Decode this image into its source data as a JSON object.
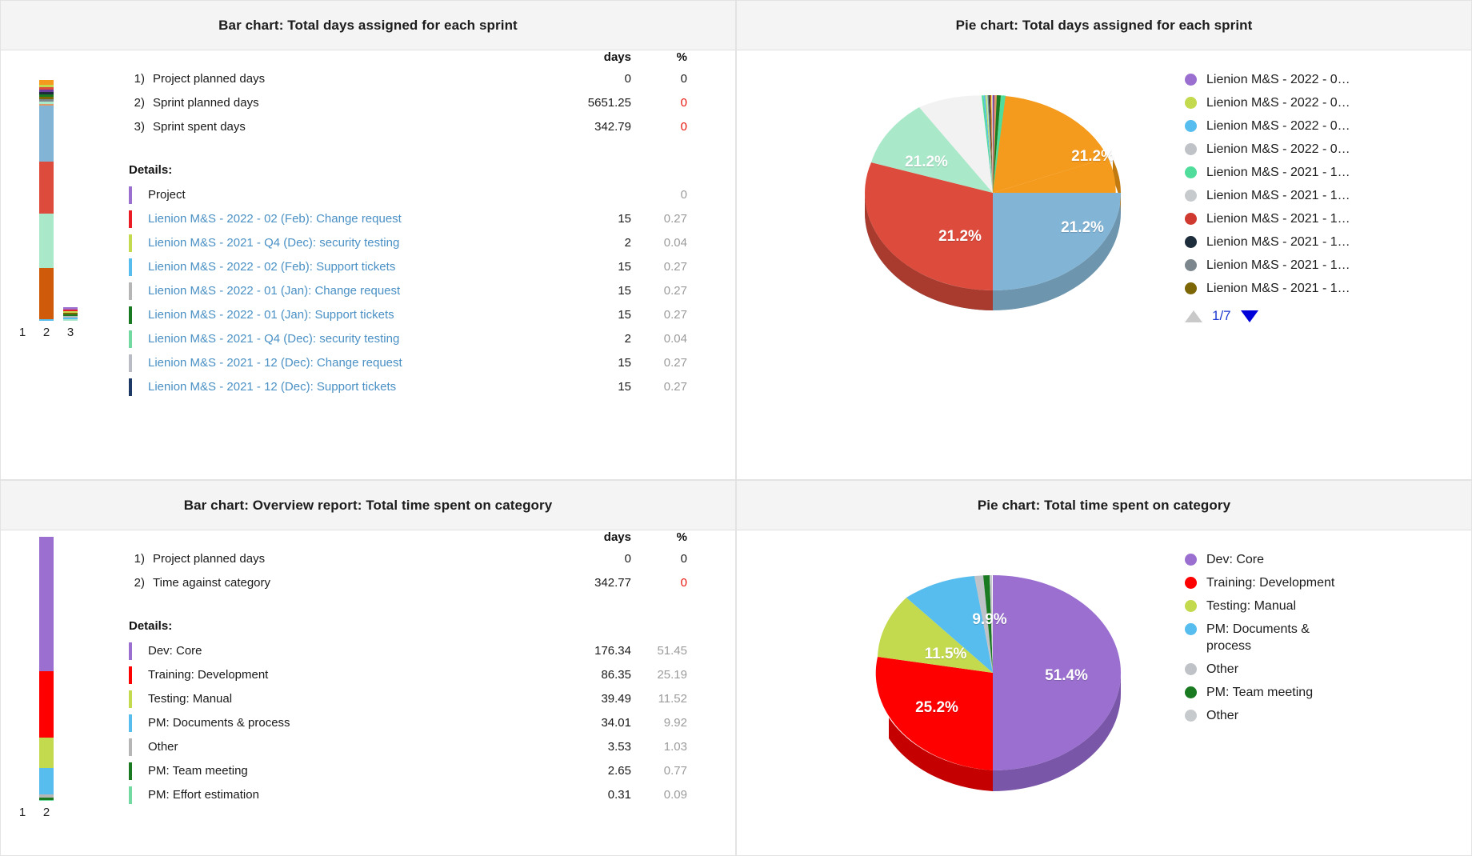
{
  "panels": {
    "bar_sprint": {
      "title": "Bar chart: Total days assigned for each sprint",
      "columns": {
        "days": "days",
        "pct": "%"
      },
      "summary": [
        {
          "idx": "1)",
          "label": "Project planned days",
          "days": "0",
          "pct": "0",
          "pct_red": false
        },
        {
          "idx": "2)",
          "label": "Sprint planned days",
          "days": "5651.25",
          "pct": "0",
          "pct_red": true
        },
        {
          "idx": "3)",
          "label": "Sprint spent days",
          "days": "342.79",
          "pct": "0",
          "pct_red": true
        }
      ],
      "details_label": "Details:",
      "details": [
        {
          "color": "#9a6fd0",
          "label": "Project",
          "days": "",
          "pct": "0",
          "link": false
        },
        {
          "color": "#ec1c24",
          "label": "Lienion M&S - 2022 - 02 (Feb): Change request",
          "days": "15",
          "pct": "0.27",
          "link": true
        },
        {
          "color": "#c3d94e",
          "label": "Lienion M&S - 2021 - Q4 (Dec): security testing",
          "days": "2",
          "pct": "0.04",
          "link": true
        },
        {
          "color": "#56bdee",
          "label": "Lienion M&S - 2022 - 02 (Feb): Support tickets",
          "days": "15",
          "pct": "0.27",
          "link": true
        },
        {
          "color": "#b6b6b6",
          "label": "Lienion M&S - 2022 - 01 (Jan): Change request",
          "days": "15",
          "pct": "0.27",
          "link": true
        },
        {
          "color": "#1a7a22",
          "label": "Lienion M&S - 2022 - 01 (Jan): Support tickets",
          "days": "15",
          "pct": "0.27",
          "link": true
        },
        {
          "color": "#72d9a0",
          "label": "Lienion M&S - 2021 - Q4 (Dec): security testing",
          "days": "2",
          "pct": "0.04",
          "link": true
        },
        {
          "color": "#b9bcc4",
          "label": "Lienion M&S - 2021 - 12 (Dec): Change request",
          "days": "15",
          "pct": "0.27",
          "link": true
        },
        {
          "color": "#1d3a66",
          "label": "Lienion M&S - 2021 - 12 (Dec): Support tickets",
          "days": "15",
          "pct": "0.27",
          "link": true
        }
      ],
      "axis_ticks": [
        "1",
        "2",
        "3"
      ]
    },
    "pie_sprint": {
      "title": "Pie chart: Total days assigned for each sprint",
      "legend": [
        {
          "color": "#9a6fd0",
          "label": "Lienion M&S - 2022 - 0…"
        },
        {
          "color": "#c3d94e",
          "label": "Lienion M&S - 2022 - 0…"
        },
        {
          "color": "#56bdee",
          "label": "Lienion M&S - 2022 - 0…"
        },
        {
          "color": "#bfc2c6",
          "label": "Lienion M&S - 2022 - 0…"
        },
        {
          "color": "#50dd9b",
          "label": "Lienion M&S - 2021 - 1…"
        },
        {
          "color": "#c7cacd",
          "label": "Lienion M&S - 2021 - 1…"
        },
        {
          "color": "#d0392f",
          "label": "Lienion M&S - 2021 - 1…"
        },
        {
          "color": "#1e2d3c",
          "label": "Lienion M&S - 2021 - 1…"
        },
        {
          "color": "#7b878c",
          "label": "Lienion M&S - 2021 - 1…"
        },
        {
          "color": "#7c6606",
          "label": "Lienion M&S - 2021 - 1…"
        }
      ],
      "pager": {
        "prev": "▲",
        "count": "1/7",
        "next": "▼"
      }
    },
    "bar_category": {
      "title": "Bar chart: Overview report: Total time spent on category",
      "columns": {
        "days": "days",
        "pct": "%"
      },
      "summary": [
        {
          "idx": "1)",
          "label": "Project planned days",
          "days": "0",
          "pct": "0",
          "pct_red": false
        },
        {
          "idx": "2)",
          "label": "Time against category",
          "days": "342.77",
          "pct": "0",
          "pct_red": true
        }
      ],
      "details_label": "Details:",
      "details": [
        {
          "color": "#9a6fd0",
          "label": "Dev: Core",
          "days": "176.34",
          "pct": "51.45"
        },
        {
          "color": "#fe0000",
          "label": "Training: Development",
          "days": "86.35",
          "pct": "25.19"
        },
        {
          "color": "#c3d94e",
          "label": "Testing: Manual",
          "days": "39.49",
          "pct": "11.52"
        },
        {
          "color": "#56bdee",
          "label": "PM: Documents & process",
          "days": "34.01",
          "pct": "9.92"
        },
        {
          "color": "#b6b6b6",
          "label": "Other",
          "days": "3.53",
          "pct": "1.03"
        },
        {
          "color": "#1a7a22",
          "label": "PM: Team meeting",
          "days": "2.65",
          "pct": "0.77"
        },
        {
          "color": "#72d9a0",
          "label": "PM: Effort estimation",
          "days": "0.31",
          "pct": "0.09"
        }
      ],
      "axis_ticks": [
        "1",
        "2"
      ]
    },
    "pie_category": {
      "title": "Pie chart: Total time spent on category",
      "legend": [
        {
          "color": "#9a6fd0",
          "label": "Dev: Core"
        },
        {
          "color": "#fe0000",
          "label": "Training: Development"
        },
        {
          "color": "#c3d94e",
          "label": "Testing: Manual"
        },
        {
          "color": "#56bdee",
          "label": "PM: Documents & process"
        },
        {
          "color": "#bfc2c6",
          "label": "Other"
        },
        {
          "color": "#1a7a22",
          "label": "PM: Team meeting"
        },
        {
          "color": "#c7cacd",
          "label": "Other"
        }
      ]
    }
  },
  "chart_data": [
    {
      "type": "bar",
      "title": "Bar chart: Total days assigned for each sprint",
      "stacked": true,
      "categories": [
        "1",
        "2",
        "3"
      ],
      "xlabel": "",
      "ylabel": "days",
      "series": [
        {
          "name": "Project planned days",
          "values": [
            0,
            0,
            0
          ]
        },
        {
          "name": "Sprint planned days",
          "values": [
            0,
            5651.25,
            0
          ]
        },
        {
          "name": "Sprint spent days",
          "values": [
            0,
            0,
            342.79
          ]
        }
      ],
      "segments_column_2": [
        {
          "label": "Lienion M&S - 2022 - 02 (Feb): Change request",
          "value": 15,
          "pct": 0.27,
          "color": "#ec1c24"
        },
        {
          "label": "Lienion M&S - 2021 - Q4 (Dec): security testing",
          "value": 2,
          "pct": 0.04,
          "color": "#c3d94e"
        },
        {
          "label": "Lienion M&S - 2022 - 02 (Feb): Support tickets",
          "value": 15,
          "pct": 0.27,
          "color": "#56bdee"
        },
        {
          "label": "Lienion M&S - 2022 - 01 (Jan): Change request",
          "value": 15,
          "pct": 0.27,
          "color": "#b6b6b6"
        },
        {
          "label": "Lienion M&S - 2022 - 01 (Jan): Support tickets",
          "value": 15,
          "pct": 0.27,
          "color": "#1a7a22"
        },
        {
          "label": "Lienion M&S - 2021 - Q4 (Dec): security testing",
          "value": 2,
          "pct": 0.04,
          "color": "#72d9a0"
        },
        {
          "label": "Lienion M&S - 2021 - 12 (Dec): Change request",
          "value": 15,
          "pct": 0.27,
          "color": "#b9bcc4"
        },
        {
          "label": "Lienion M&S - 2021 - 12 (Dec): Support tickets",
          "value": 15,
          "pct": 0.27,
          "color": "#1d3a66"
        }
      ]
    },
    {
      "type": "pie",
      "title": "Pie chart: Total days assigned for each sprint",
      "legend_position": "right",
      "labels": [
        "21.2%",
        "21.2%",
        "21.2%",
        "21.2%"
      ],
      "slices": [
        {
          "label": "21.2%",
          "value": 21.2,
          "color": "#f49a1c"
        },
        {
          "label": "21.2%",
          "value": 21.2,
          "color": "#82b4d6"
        },
        {
          "label": "21.2%",
          "value": 21.2,
          "color": "#dd4b3c"
        },
        {
          "label": "21.2%",
          "value": 21.2,
          "color": "#a9e8c9"
        },
        {
          "label": "",
          "value": 10.5,
          "color": "#f2f2f2"
        },
        {
          "label": "",
          "value": 0.6,
          "color": "#50dd9b"
        },
        {
          "label": "",
          "value": 0.6,
          "color": "#1a7a22"
        },
        {
          "label": "",
          "value": 0.6,
          "color": "#e09a6a"
        },
        {
          "label": "",
          "value": 0.6,
          "color": "#c9b5e0"
        },
        {
          "label": "",
          "value": 0.6,
          "color": "#f2e96a"
        },
        {
          "label": "",
          "value": 0.6,
          "color": "#6b3fa0"
        },
        {
          "label": "",
          "value": 0.5,
          "color": "#7c6606"
        },
        {
          "label": "",
          "value": 0.5,
          "color": "#1e2d3c"
        },
        {
          "label": "",
          "value": 0.5,
          "color": "#d0392f"
        },
        {
          "label": "",
          "value": 0.5,
          "color": "#7b878c"
        },
        {
          "label": "",
          "value": 0.4,
          "color": "#56bdee"
        },
        {
          "label": "",
          "value": 0.4,
          "color": "#c3d94e"
        }
      ]
    },
    {
      "type": "bar",
      "title": "Bar chart: Overview report: Total time spent on category",
      "stacked": true,
      "categories": [
        "1",
        "2"
      ],
      "xlabel": "",
      "ylabel": "days",
      "series": [
        {
          "name": "Project planned days",
          "values": [
            0,
            0
          ]
        },
        {
          "name": "Time against category",
          "values": [
            0,
            342.77
          ]
        }
      ],
      "segments_column_2": [
        {
          "label": "Dev: Core",
          "value": 176.34,
          "pct": 51.45,
          "color": "#9a6fd0"
        },
        {
          "label": "Training: Development",
          "value": 86.35,
          "pct": 25.19,
          "color": "#fe0000"
        },
        {
          "label": "Testing: Manual",
          "value": 39.49,
          "pct": 11.52,
          "color": "#c3d94e"
        },
        {
          "label": "PM: Documents & process",
          "value": 34.01,
          "pct": 9.92,
          "color": "#56bdee"
        },
        {
          "label": "Other",
          "value": 3.53,
          "pct": 1.03,
          "color": "#b6b6b6"
        },
        {
          "label": "PM: Team meeting",
          "value": 2.65,
          "pct": 0.77,
          "color": "#1a7a22"
        },
        {
          "label": "PM: Effort estimation",
          "value": 0.31,
          "pct": 0.09,
          "color": "#72d9a0"
        }
      ]
    },
    {
      "type": "pie",
      "title": "Pie chart: Total time spent on category",
      "legend_position": "right",
      "slices": [
        {
          "label": "51.4%",
          "value": 51.4,
          "color": "#9a6fd0"
        },
        {
          "label": "25.2%",
          "value": 25.2,
          "color": "#fe0000"
        },
        {
          "label": "11.5%",
          "value": 11.5,
          "color": "#c3d94e"
        },
        {
          "label": "9.9%",
          "value": 9.9,
          "color": "#56bdee"
        },
        {
          "label": "",
          "value": 1.0,
          "color": "#bfc2c6"
        },
        {
          "label": "",
          "value": 0.8,
          "color": "#1a7a22"
        },
        {
          "label": "",
          "value": 0.2,
          "color": "#c7cacd"
        }
      ]
    }
  ]
}
